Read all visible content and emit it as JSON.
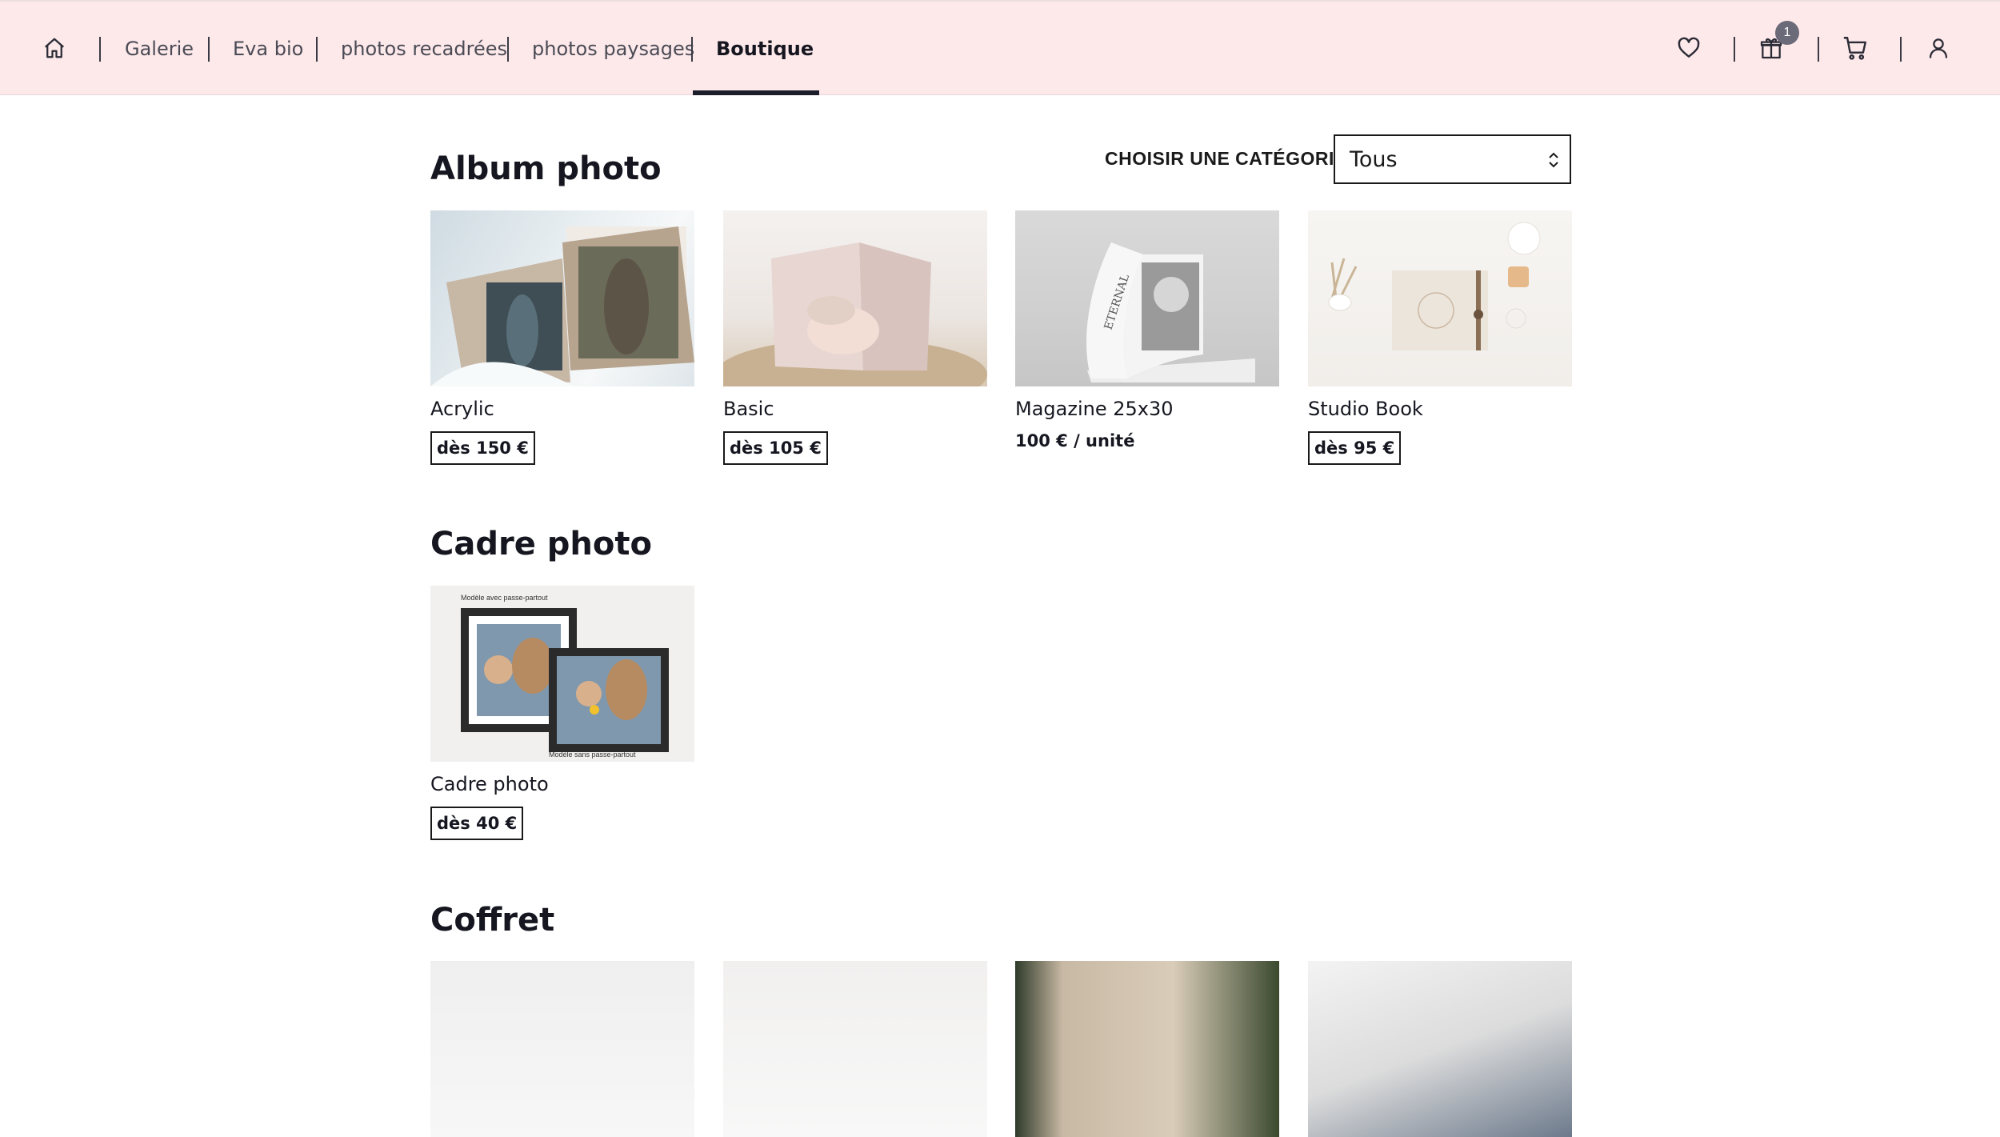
{
  "nav": {
    "home_icon": "home-icon",
    "links": [
      "Galerie",
      "Eva bio",
      "photos recadrées",
      "photos paysages",
      "Boutique"
    ],
    "active_link": "Boutique",
    "icons": [
      "heart-icon",
      "gift-icon",
      "cart-icon",
      "user-icon"
    ],
    "gift_badge": "1"
  },
  "filter": {
    "label": "CHOISIR UNE CATÉGORIE :",
    "selected": "Tous"
  },
  "sections": [
    {
      "title": "Album photo",
      "products": [
        {
          "name": "Acrylic",
          "price": "dès 150 €"
        },
        {
          "name": "Basic",
          "price": "dès 105 €"
        },
        {
          "name": "Magazine 25x30",
          "price": "100 € / unité"
        },
        {
          "name": "Studio Book",
          "price": "dès 95 €"
        }
      ]
    },
    {
      "title": "Cadre photo",
      "products": [
        {
          "name": "Cadre photo",
          "price": "dès 40 €",
          "caption_top": "Modèle avec passe-partout",
          "caption_bottom": "Modèle sans passe-partout"
        }
      ]
    },
    {
      "title": "Coffret",
      "products": []
    }
  ],
  "magazine_cover_text": "ETERNAL",
  "colors": {
    "nav_bg": "#fde8ea",
    "text_dark": "#15161f",
    "badge": "#6b6a78"
  }
}
